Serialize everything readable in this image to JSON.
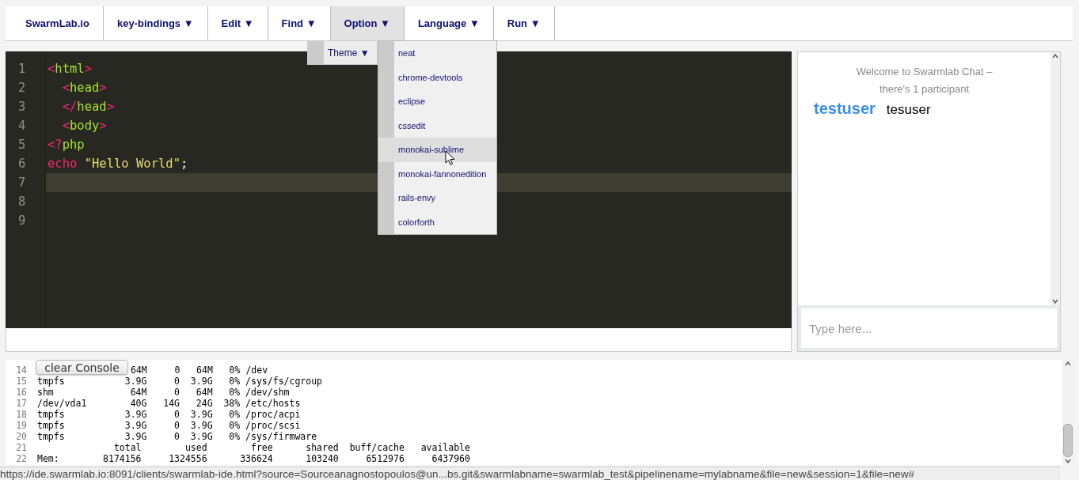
{
  "menu": [
    {
      "label": "SwarmLab.io",
      "selected": false
    },
    {
      "label": "key-bindings ▼",
      "selected": false
    },
    {
      "label": "Edit ▼",
      "selected": false
    },
    {
      "label": "Find ▼",
      "selected": false
    },
    {
      "label": "Option ▼",
      "selected": true
    },
    {
      "label": "Language ▼",
      "selected": false
    },
    {
      "label": "Run ▼",
      "selected": false
    }
  ],
  "submenu": {
    "label": "Theme ▼"
  },
  "themes": [
    {
      "label": "neat",
      "selected": false
    },
    {
      "label": "chrome-devtools",
      "selected": false
    },
    {
      "label": "eclipse",
      "selected": false
    },
    {
      "label": "cssedit",
      "selected": false
    },
    {
      "label": "monokai-sublime",
      "selected": true
    },
    {
      "label": "monokai-fannonedition",
      "selected": false
    },
    {
      "label": "rails-envy",
      "selected": false
    },
    {
      "label": "colorforth",
      "selected": false
    }
  ],
  "editor": {
    "lines": [
      {
        "number": "1",
        "active": false,
        "tokens": [
          {
            "text": "<",
            "kind": "tag"
          },
          {
            "text": "html",
            "kind": "name"
          },
          {
            "text": ">",
            "kind": "tag"
          }
        ]
      },
      {
        "number": "2",
        "active": false,
        "tokens": [
          {
            "text": "  <",
            "kind": "tag"
          },
          {
            "text": "head",
            "kind": "name"
          },
          {
            "text": ">",
            "kind": "tag"
          }
        ]
      },
      {
        "number": "3",
        "active": false,
        "tokens": [
          {
            "text": "  </",
            "kind": "tag"
          },
          {
            "text": "head",
            "kind": "name"
          },
          {
            "text": ">",
            "kind": "tag"
          }
        ]
      },
      {
        "number": "4",
        "active": false,
        "tokens": [
          {
            "text": "  <",
            "kind": "tag"
          },
          {
            "text": "body",
            "kind": "name"
          },
          {
            "text": ">",
            "kind": "tag"
          }
        ]
      },
      {
        "number": "5",
        "active": false,
        "tokens": [
          {
            "text": "<?",
            "kind": "tag"
          },
          {
            "text": "php",
            "kind": "name"
          }
        ]
      },
      {
        "number": "6",
        "active": false,
        "tokens": [
          {
            "text": "echo",
            "kind": "tag"
          },
          {
            "text": " \"Hello World\"",
            "kind": "string"
          },
          {
            "text": ";",
            "kind": "plain"
          }
        ]
      },
      {
        "number": "7",
        "active": true
      },
      {
        "number": "8",
        "active": false
      },
      {
        "number": "9",
        "active": false
      }
    ]
  },
  "chat": {
    "welcome": [
      "Welcome to Swarmlab Chat –",
      "there's 1 participant"
    ],
    "participant": {
      "user": "testuser",
      "name": "tesuser"
    },
    "input": {
      "placeholder": "Type here..."
    }
  },
  "console": {
    "button": "clear Console",
    "lines": [
      {
        "number": "14",
        "text": "64M     0   64M   0% /dev",
        "kind": "partly_hidden"
      },
      {
        "number": "15",
        "text": "tmpfs           3.9G     0  3.9G   0% /sys/fs/cgroup",
        "kind": "full"
      },
      {
        "number": "16",
        "text": "shm              64M     0   64M   0% /dev/shm",
        "kind": "full"
      },
      {
        "number": "17",
        "text": "/dev/vda1        40G   14G   24G  38% /etc/hosts",
        "kind": "full"
      },
      {
        "number": "18",
        "text": "tmpfs           3.9G     0  3.9G   0% /proc/acpi",
        "kind": "full"
      },
      {
        "number": "19",
        "text": "tmpfs           3.9G     0  3.9G   0% /proc/scsi",
        "kind": "full"
      },
      {
        "number": "20",
        "text": "tmpfs           3.9G     0  3.9G   0% /sys/firmware",
        "kind": "full"
      },
      {
        "number": "21",
        "text": "              total        used        free      shared  buff/cache   available",
        "kind": "full"
      },
      {
        "number": "22",
        "text": "Mem:        8174156     1324556      336624      103240     6512976     6437960",
        "kind": "full"
      }
    ]
  },
  "status_url": "https://ide.swarmlab.io:8091/clients/swarmlab-ide.html?source=Sourceanagnostopoulos@un...bs.git&swarmlabname=swarmlab_test&pipelinename=mylabname&file=new&session=1&file=new#"
}
